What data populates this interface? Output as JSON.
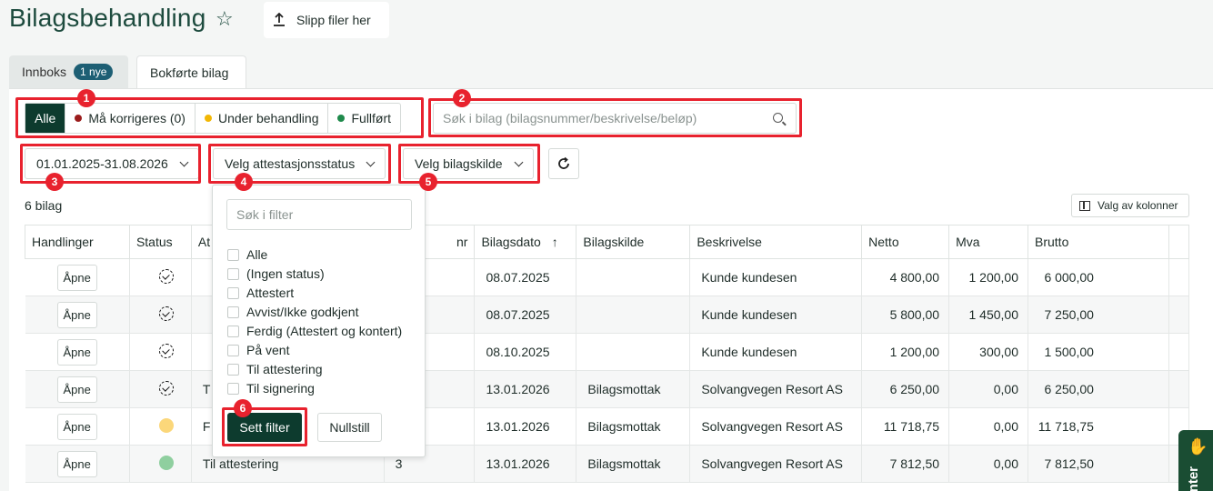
{
  "header": {
    "title": "Bilagsbehandling",
    "drop_label": "Slipp filer her"
  },
  "tabs": [
    {
      "label": "Innboks",
      "badge": "1 nye"
    },
    {
      "label": "Bokførte bilag"
    }
  ],
  "status_filter": {
    "items": [
      {
        "label": "Alle",
        "color": ""
      },
      {
        "label": "Må korrigeres (0)",
        "color": "#9b1c1c"
      },
      {
        "label": "Under behandling",
        "color": "#f2b705"
      },
      {
        "label": "Fullført",
        "color": "#1f8a4c"
      }
    ]
  },
  "search": {
    "placeholder": "Søk i bilag (bilagsnummer/beskrivelse/beløp)"
  },
  "filters": {
    "date_range": "01.01.2025-31.08.2026",
    "attest_label": "Velg attestasjonsstatus",
    "source_label": "Velg bilagskilde"
  },
  "count_label": "6 bilag",
  "columns_button": "Valg av kolonner",
  "table": {
    "headers": [
      "Handlinger",
      "Status",
      "At",
      "nr",
      "Bilagsdato",
      "Bilagskilde",
      "Beskrivelse",
      "Netto",
      "Mva",
      "Brutto"
    ],
    "rows": [
      {
        "action": "Åpne",
        "status": "icon",
        "attest": "",
        "nr": "",
        "date": "08.07.2025",
        "source": "",
        "desc": "Kunde kundesen",
        "netto": "4 800,00",
        "mva": "1 200,00",
        "brutto": "6 000,00"
      },
      {
        "action": "Åpne",
        "status": "icon",
        "attest": "",
        "nr": "",
        "date": "08.07.2025",
        "source": "",
        "desc": "Kunde kundesen",
        "netto": "5 800,00",
        "mva": "1 450,00",
        "brutto": "7 250,00"
      },
      {
        "action": "Åpne",
        "status": "icon",
        "attest": "",
        "nr": "",
        "date": "08.10.2025",
        "source": "",
        "desc": "Kunde kundesen",
        "netto": "1 200,00",
        "mva": "300,00",
        "brutto": "1 500,00"
      },
      {
        "action": "Åpne",
        "status": "icon",
        "attest": "T",
        "nr": "",
        "date": "13.01.2026",
        "source": "Bilagsmottak",
        "desc": "Solvangvegen Resort AS",
        "netto": "6 250,00",
        "mva": "0,00",
        "brutto": "6 250,00"
      },
      {
        "action": "Åpne",
        "status": "#fbd77a",
        "attest": "F",
        "nr": "",
        "date": "13.01.2026",
        "source": "Bilagsmottak",
        "desc": "Solvangvegen Resort AS",
        "netto": "11 718,75",
        "mva": "0,00",
        "brutto": "11 718,75"
      },
      {
        "action": "Åpne",
        "status": "#8fcf9f",
        "attest": "Til attestering",
        "nr": "3",
        "date": "13.01.2026",
        "source": "Bilagsmottak",
        "desc": "Solvangvegen Resort AS",
        "netto": "7 812,50",
        "mva": "0,00",
        "brutto": "7 812,50"
      }
    ]
  },
  "popup": {
    "search_placeholder": "Søk i filter",
    "options": [
      "Alle",
      "(Ingen status)",
      "Attestert",
      "Avvist/Ikke godkjent",
      "Ferdig (Attestert og kontert)",
      "På vent",
      "Til attestering",
      "Til signering"
    ],
    "apply_label": "Sett filter",
    "reset_label": "Nullstill"
  },
  "callouts": [
    "1",
    "2",
    "3",
    "4",
    "5",
    "6"
  ],
  "side_tab_label": "nter",
  "colors": {
    "primary": "#0d3b2e",
    "highlight": "#e8222e",
    "badge": "#1d5f74"
  }
}
